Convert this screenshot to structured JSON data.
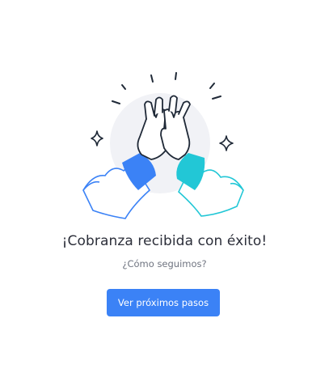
{
  "success": {
    "title": "¡Cobranza recibida con éxito!",
    "subtitle": "¿Cómo seguimos?",
    "cta_label": "Ver próximos pasos"
  },
  "illustration": {
    "icon": "high-five-illustration",
    "left_sleeve_color": "#3b82f6",
    "right_sleeve_color": "#22c7d6",
    "background_circle_color": "#f1f2f6",
    "stroke_color": "#1f2937"
  },
  "colors": {
    "primary_button": "#3b82f6",
    "title_text": "#2c2f3a",
    "subtitle_text": "#6f7480"
  }
}
